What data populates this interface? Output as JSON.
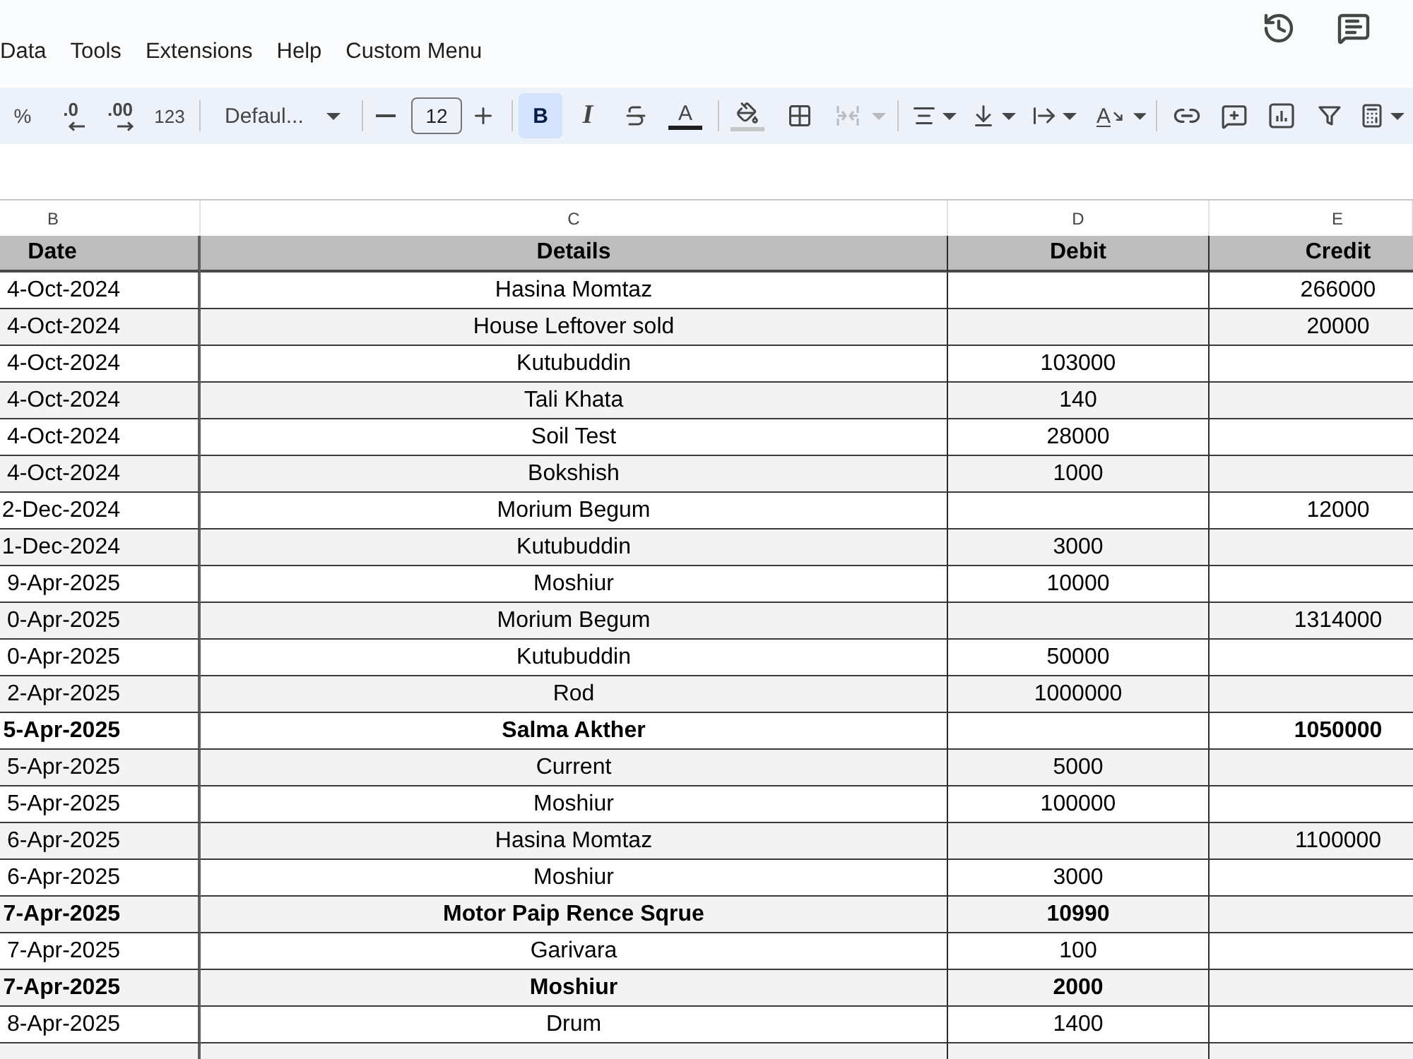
{
  "header": {
    "menu": [
      "Data",
      "Tools",
      "Extensions",
      "Help",
      "Custom Menu"
    ]
  },
  "toolbar": {
    "percent": "%",
    "decrease_decimal": ".0",
    "increase_decimal": ".00",
    "number_format": "123",
    "font": "Defaul...",
    "font_size": "12",
    "styles": [
      {
        "kind": "bold",
        "label": "B",
        "selected": true
      },
      {
        "kind": "italic",
        "label": "I",
        "selected": false
      },
      {
        "kind": "strikethrough",
        "selected": false
      }
    ],
    "text_color": "A",
    "merge": {
      "disabled": true
    },
    "text_rotation": "A"
  },
  "sheet": {
    "column_letters": [
      "B",
      "C",
      "D",
      "E"
    ],
    "headers": [
      "Date",
      "Details",
      "Debit",
      "Credit"
    ],
    "rows": [
      {
        "date": "4-Oct-2024",
        "details": "Hasina Momtaz",
        "credit": "266000",
        "bold": false
      },
      {
        "date": "4-Oct-2024",
        "details": "House Leftover sold",
        "credit": "20000",
        "bold": false
      },
      {
        "date": "4-Oct-2024",
        "details": "Kutubuddin",
        "debit": "103000",
        "bold": false
      },
      {
        "date": "4-Oct-2024",
        "details": "Tali Khata",
        "debit": "140",
        "bold": false
      },
      {
        "date": "4-Oct-2024",
        "details": "Soil Test",
        "debit": "28000",
        "bold": false
      },
      {
        "date": "4-Oct-2024",
        "details": "Bokshish",
        "debit": "1000",
        "bold": false
      },
      {
        "date": "2-Dec-2024",
        "details": "Morium Begum",
        "credit": "12000",
        "bold": false
      },
      {
        "date": "1-Dec-2024",
        "details": "Kutubuddin",
        "debit": "3000",
        "bold": false
      },
      {
        "date": "9-Apr-2025",
        "details": "Moshiur",
        "debit": "10000",
        "bold": false
      },
      {
        "date": "0-Apr-2025",
        "details": "Morium Begum",
        "credit": "1314000",
        "bold": false
      },
      {
        "date": "0-Apr-2025",
        "details": "Kutubuddin",
        "debit": "50000",
        "bold": false
      },
      {
        "date": "2-Apr-2025",
        "details": "Rod",
        "debit": "1000000",
        "bold": false
      },
      {
        "date": "5-Apr-2025",
        "details": "Salma Akther",
        "credit": "1050000",
        "bold": true
      },
      {
        "date": "5-Apr-2025",
        "details": "Current",
        "debit": "5000",
        "bold": false
      },
      {
        "date": "5-Apr-2025",
        "details": "Moshiur",
        "debit": "100000",
        "bold": false
      },
      {
        "date": "6-Apr-2025",
        "details": "Hasina Momtaz",
        "credit": "1100000",
        "bold": false
      },
      {
        "date": "6-Apr-2025",
        "details": "Moshiur",
        "debit": "3000",
        "bold": false
      },
      {
        "date": "7-Apr-2025",
        "details": "Motor Paip Rence Sqrue",
        "debit": "10990",
        "bold": true
      },
      {
        "date": "7-Apr-2025",
        "details": "Garivara",
        "debit": "100",
        "bold": false
      },
      {
        "date": "7-Apr-2025",
        "details": "Moshiur",
        "debit": "2000",
        "bold": true
      },
      {
        "date": "8-Apr-2025",
        "details": "Drum",
        "debit": "1400",
        "bold": false
      }
    ]
  }
}
